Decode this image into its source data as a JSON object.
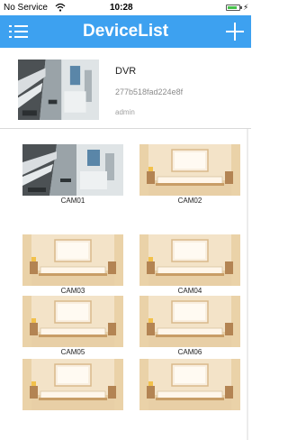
{
  "status_bar": {
    "carrier": "No Service",
    "time": "10:28",
    "battery_level": 0.85,
    "icons": [
      "wifi-icon",
      "battery-icon",
      "charging-icon"
    ]
  },
  "nav": {
    "title": "DeviceList",
    "left_icon": "menu-icon",
    "right_icon": "add-icon",
    "bar_color": "#3da1f0"
  },
  "device": {
    "name": "DVR",
    "id": "277b518fad224e8f",
    "user": "admin"
  },
  "channels": [
    {
      "label": "CAM01",
      "preview": "street-camera"
    },
    {
      "label": "CAM02",
      "preview": "room-placeholder"
    },
    {
      "label": "CAM03",
      "preview": "room-placeholder"
    },
    {
      "label": "CAM04",
      "preview": "room-placeholder"
    },
    {
      "label": "CAM05",
      "preview": "room-placeholder"
    },
    {
      "label": "CAM06",
      "preview": "room-placeholder"
    },
    {
      "label": "",
      "preview": "room-placeholder"
    },
    {
      "label": "",
      "preview": "room-placeholder"
    }
  ]
}
